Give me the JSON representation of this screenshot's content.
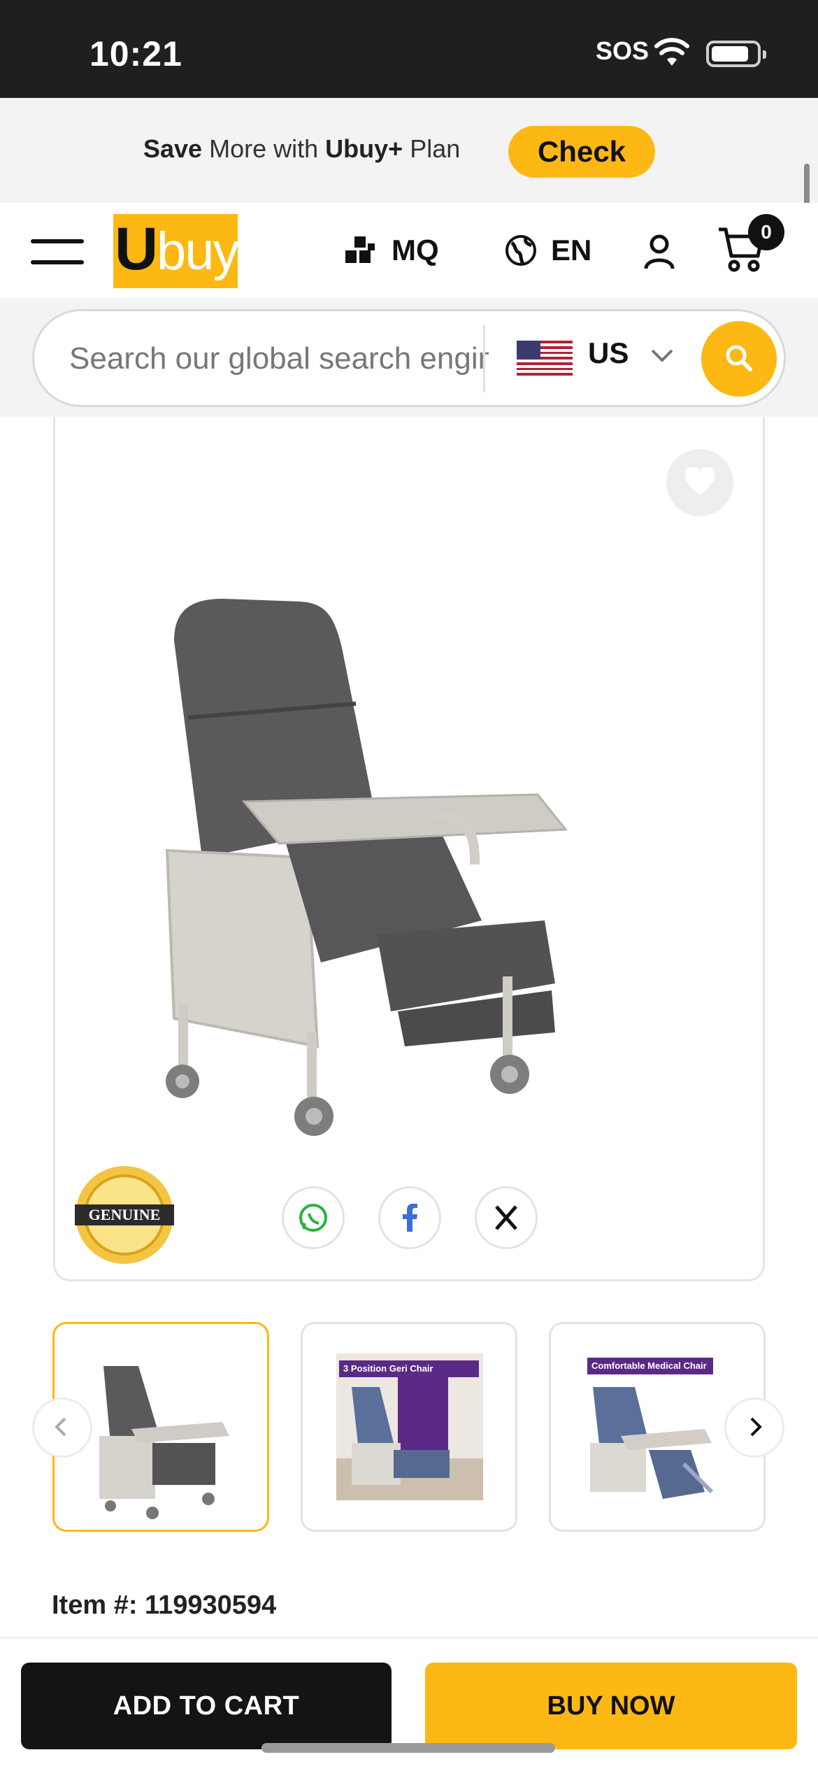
{
  "status_bar": {
    "time": "10:21",
    "sos": "SOS"
  },
  "promo": {
    "save": "Save",
    "more_with": "More with",
    "brand_plus": "Ubuy+",
    "plan": "Plan",
    "check_label": "Check"
  },
  "header": {
    "logo_u": "U",
    "logo_buy": "buy",
    "store_label": "MQ",
    "language_label": "EN",
    "cart_count": "0"
  },
  "search": {
    "placeholder": "Search our global search engine",
    "country": "US"
  },
  "product": {
    "badge_text": "GENUINE",
    "item_label": "Item #:",
    "item_number": "119930594"
  },
  "thumbnails": [
    {
      "caption": ""
    },
    {
      "caption": "3 Position Geri Chair"
    },
    {
      "caption": "Comfortable Medical Chair"
    }
  ],
  "actions": {
    "add_to_cart": "ADD TO CART",
    "buy_now": "BUY NOW"
  },
  "colors": {
    "accent": "#fdb813",
    "dark": "#141414"
  }
}
